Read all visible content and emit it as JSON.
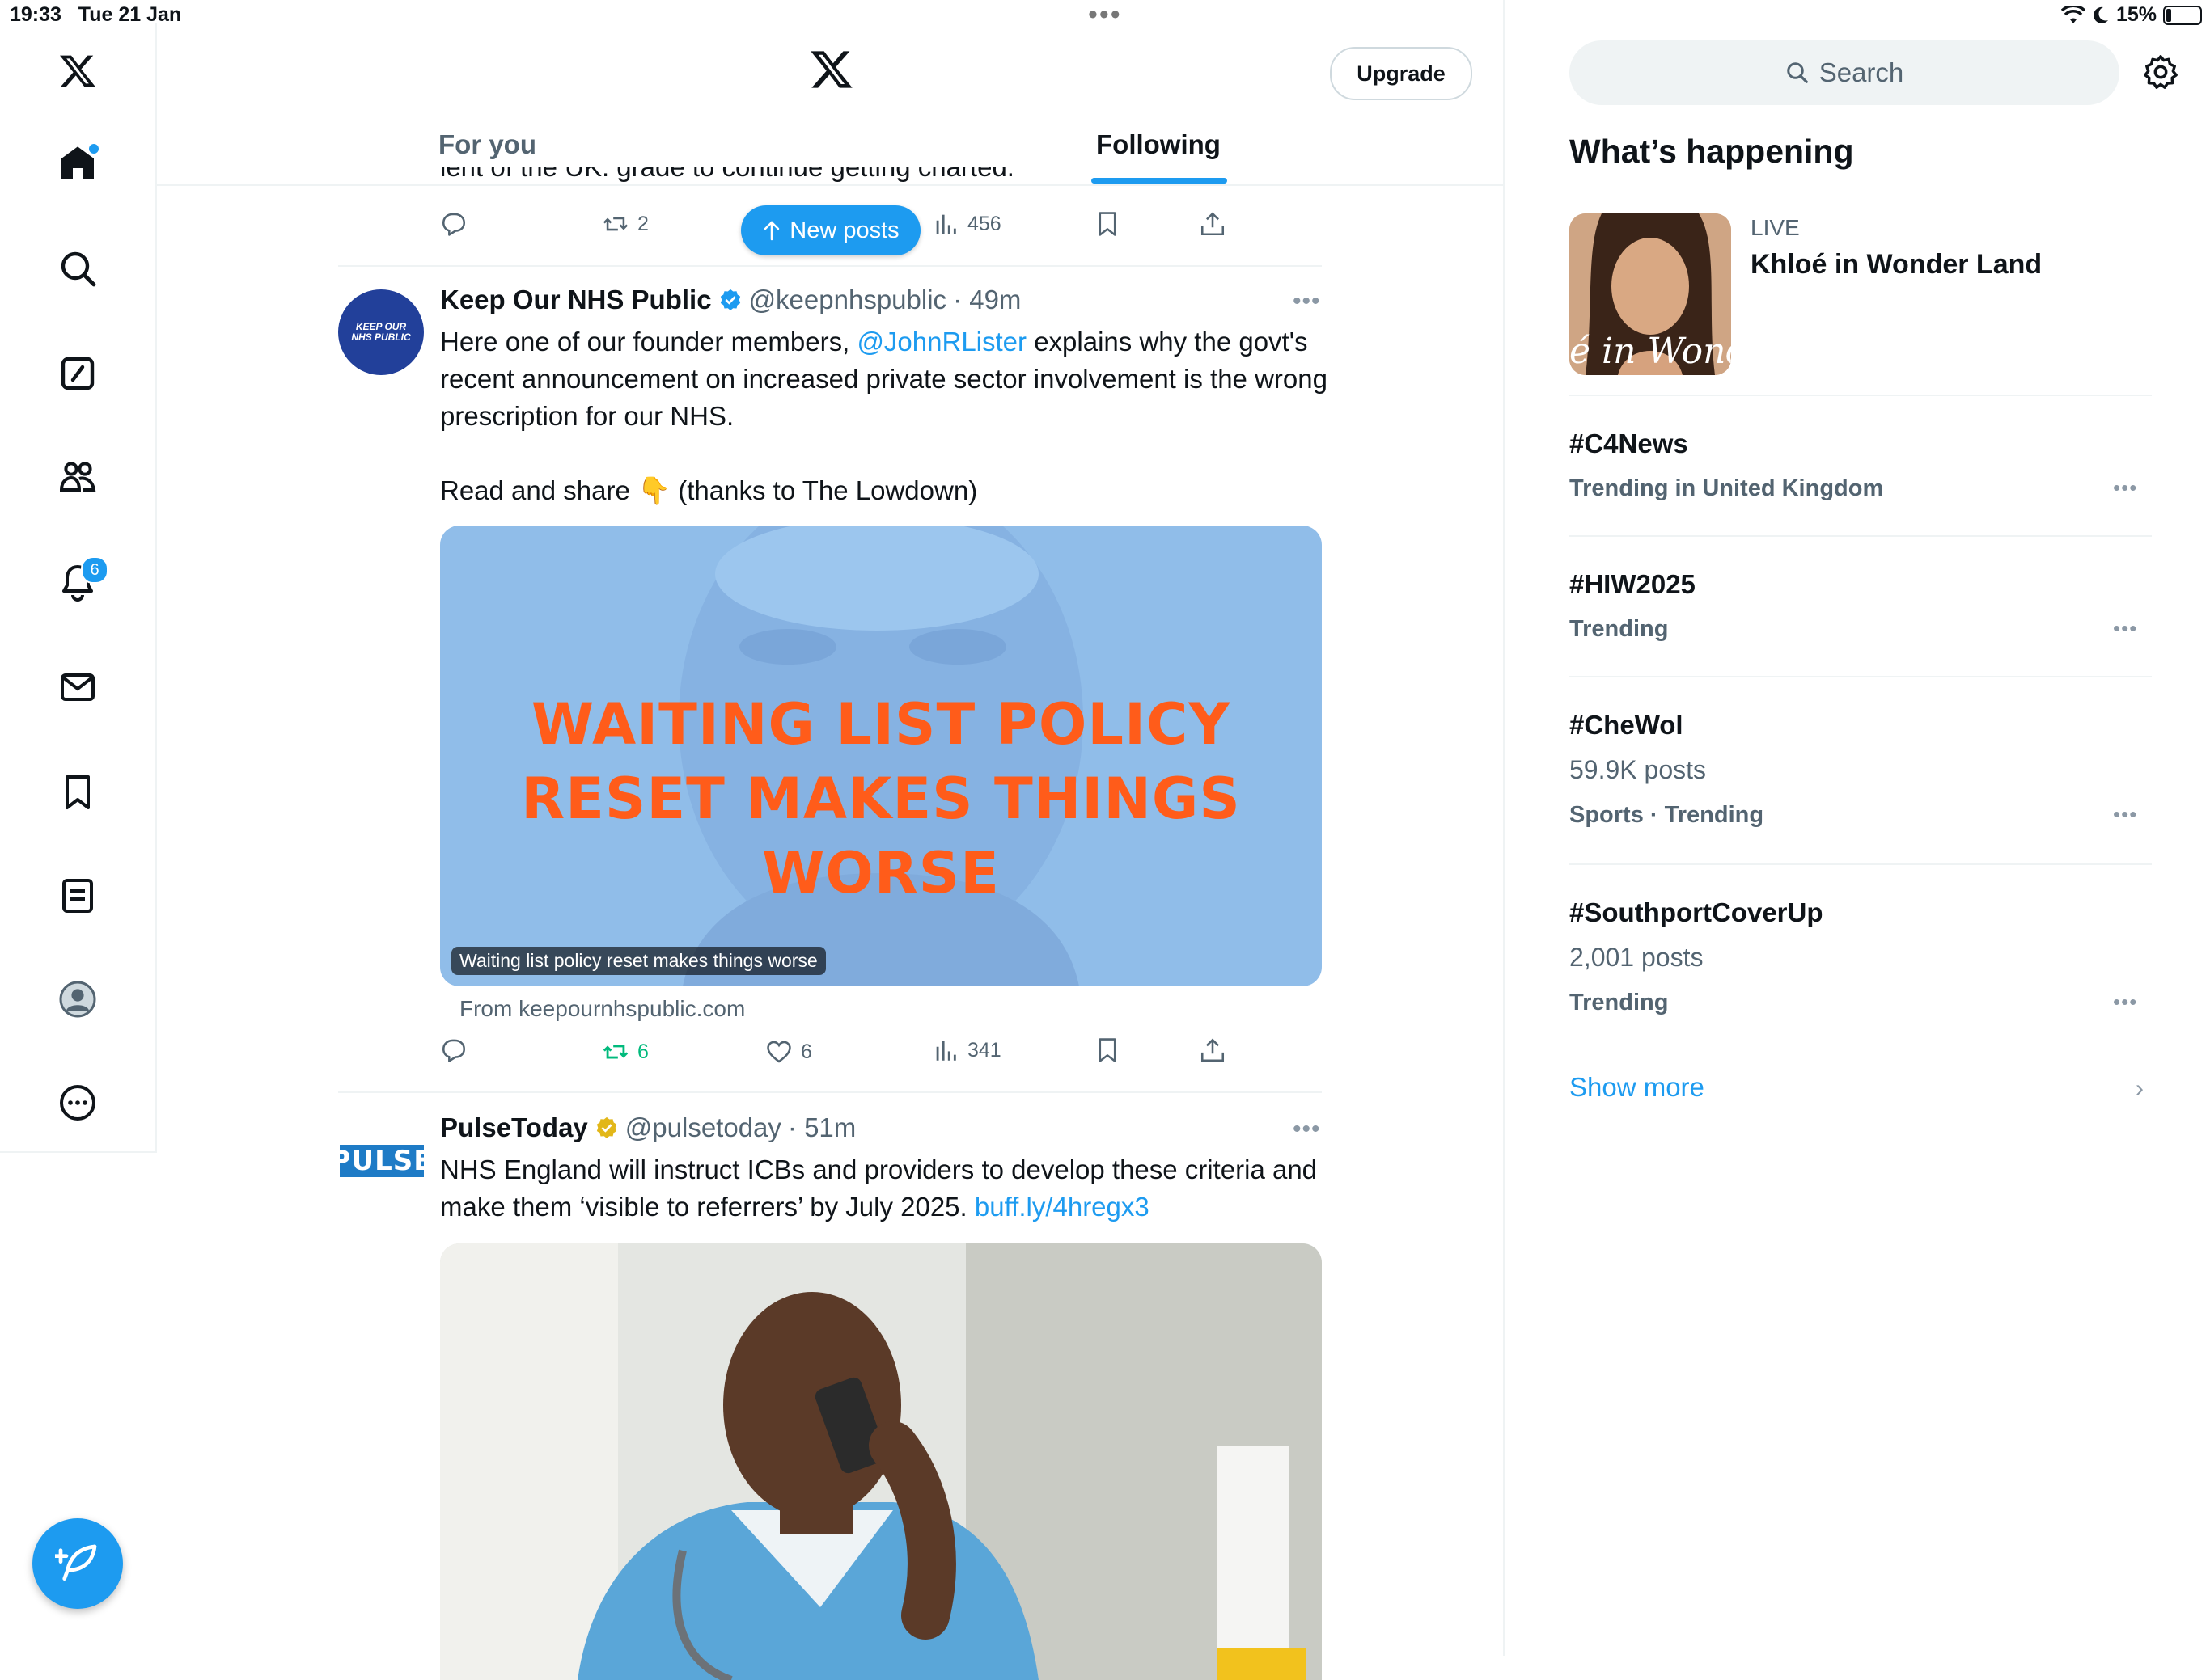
{
  "status": {
    "time": "19:33",
    "date": "Tue 21 Jan",
    "battery": "15%"
  },
  "nav": {
    "items": [
      {
        "name": "x-logo-icon"
      },
      {
        "name": "home-icon"
      },
      {
        "name": "explore-icon"
      },
      {
        "name": "grok-icon"
      },
      {
        "name": "communities-icon"
      },
      {
        "name": "notifications-icon",
        "badge": "6"
      },
      {
        "name": "messages-icon"
      },
      {
        "name": "bookmarks-icon"
      },
      {
        "name": "lists-icon"
      },
      {
        "name": "profile-icon"
      },
      {
        "name": "more-icon"
      }
    ],
    "compose_icon": "compose-post-icon"
  },
  "header": {
    "upgrade_label": "Upgrade",
    "tabs": [
      {
        "label": "For you",
        "selected": false
      },
      {
        "label": "Following",
        "selected": true
      }
    ]
  },
  "feed": {
    "new_posts_label": "New posts",
    "prev_tweet": {
      "cut_text": "lent of the UK. grade to continue getting charted.",
      "replies": "",
      "reposts": "2",
      "views": "456"
    },
    "tweets": [
      {
        "avatar_text": "KEEP OUR NHS PUBLIC",
        "name": "Keep Our NHS Public",
        "handle": "@keepnhspublic",
        "time": "· 49m",
        "text_before_mention": "Here one of our founder members, ",
        "mention": "@JohnRLister",
        "text_after_mention": " explains why the govt's recent announcement on increased private sector involvement is the wrong prescription for our NHS.",
        "text_line2": "Read and share 👇 (thanks to The Lowdown)",
        "card_headline": "WAITING LIST POLICY RESET MAKES THINGS WORSE",
        "card_caption": "Waiting list policy reset makes things worse",
        "card_source": "From keepournhspublic.com",
        "replies": "",
        "reposts": "6",
        "likes": "6",
        "views": "341"
      },
      {
        "avatar_text": "PULSE",
        "name": "PulseToday",
        "handle": "@pulsetoday",
        "time": "· 51m",
        "text": "NHS England will instruct ICBs and providers to develop these criteria and make them ‘visible to referrers’ by July 2025. ",
        "link": "buff.ly/4hregx3"
      }
    ]
  },
  "sidebar": {
    "search_placeholder": "Search",
    "title": "What’s happening",
    "live": {
      "label": "LIVE",
      "title": "Khloé in Wonder Land",
      "thumb_text": "é in Wonder L"
    },
    "trends": [
      {
        "tag": "#C4News",
        "count": "",
        "meta": "Trending in United Kingdom"
      },
      {
        "tag": "#HIW2025",
        "count": "",
        "meta": "Trending"
      },
      {
        "tag": "#CheWol",
        "count": "59.9K posts",
        "meta": "Sports · Trending"
      },
      {
        "tag": "#SouthportCoverUp",
        "count": "2,001 posts",
        "meta": "Trending"
      }
    ],
    "show_more": "Show more"
  },
  "colors": {
    "accent": "#1d9bf0",
    "repost_active": "#00ba7c",
    "card_bg": "#90bde9",
    "card_headline": "#ff5c1a"
  }
}
